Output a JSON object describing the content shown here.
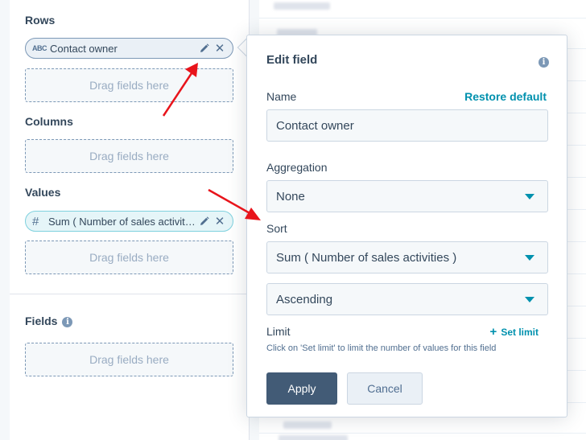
{
  "builder": {
    "rows_label": "Rows",
    "rows_chip": {
      "type_icon": "ABC",
      "text": "Contact owner"
    },
    "columns_label": "Columns",
    "values_label": "Values",
    "values_chip": {
      "type_icon": "#",
      "text": "Sum ( Number of sales activities )"
    },
    "fields_label": "Fields",
    "drop_placeholder": "Drag fields here"
  },
  "popover": {
    "title": "Edit field",
    "info_icon": "i",
    "name_label": "Name",
    "restore_link": "Restore default",
    "name_value": "Contact owner",
    "aggregation_label": "Aggregation",
    "aggregation_value": "None",
    "sort_label": "Sort",
    "sort_field_value": "Sum ( Number of sales activities )",
    "sort_order_value": "Ascending",
    "limit_label": "Limit",
    "set_limit_plus": "+",
    "set_limit_link": "Set limit",
    "limit_hint": "Click on 'Set limit' to limit the number of values for this field",
    "apply_label": "Apply",
    "cancel_label": "Cancel"
  },
  "colors": {
    "accent": "#0091ae",
    "primary_button": "#425b76",
    "annotation_arrow": "#e8141b"
  }
}
